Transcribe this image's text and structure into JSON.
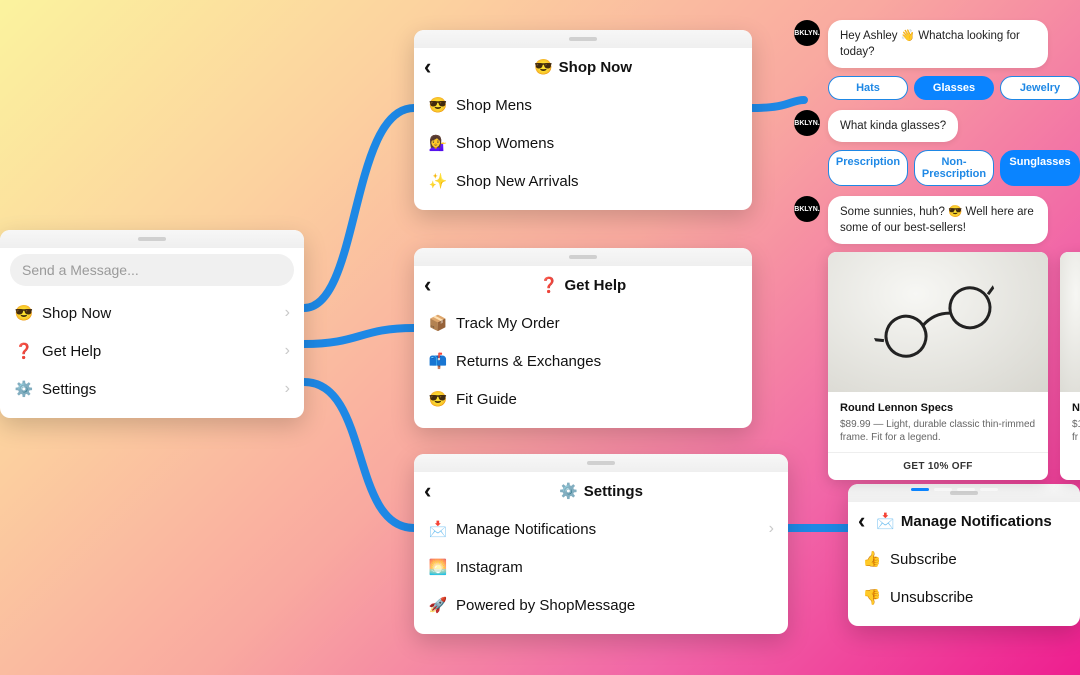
{
  "root": {
    "search_placeholder": "Send a Message...",
    "items": [
      {
        "icon": "😎",
        "label": "Shop Now"
      },
      {
        "icon": "❓",
        "label": "Get Help"
      },
      {
        "icon": "⚙️",
        "label": "Settings"
      }
    ]
  },
  "shop": {
    "back": "‹",
    "title_icon": "😎",
    "title": "Shop Now",
    "items": [
      {
        "icon": "😎",
        "label": "Shop Mens"
      },
      {
        "icon": "💁‍♀️",
        "label": "Shop Womens"
      },
      {
        "icon": "✨",
        "label": "Shop New Arrivals"
      }
    ]
  },
  "help": {
    "back": "‹",
    "title_icon": "❓",
    "title": "Get Help",
    "items": [
      {
        "icon": "📦",
        "label": "Track My Order"
      },
      {
        "icon": "📫",
        "label": "Returns & Exchanges"
      },
      {
        "icon": "😎",
        "label": "Fit Guide"
      }
    ]
  },
  "settings": {
    "back": "‹",
    "title_icon": "⚙️",
    "title": "Settings",
    "items": [
      {
        "icon": "📩",
        "label": "Manage Notifications",
        "chev": true
      },
      {
        "icon": "🌅",
        "label": "Instagram"
      },
      {
        "icon": "🚀",
        "label": "Powered by ShopMessage"
      }
    ]
  },
  "notifications": {
    "back": "‹",
    "title_icon": "📩",
    "title": "Manage Notifications",
    "items": [
      {
        "icon": "👍",
        "label": "Subscribe"
      },
      {
        "icon": "👎",
        "label": "Unsubscribe"
      }
    ]
  },
  "chat": {
    "brand": "BKLYN.",
    "msg1": "Hey Ashley 👋 Whatcha looking for today?",
    "chips1": [
      "Hats",
      "Glasses",
      "Jewelry"
    ],
    "chips1_selected": 1,
    "msg2": "What kinda glasses?",
    "chips2": [
      "Prescription",
      "Non-Prescription",
      "Sunglasses"
    ],
    "chips2_selected": 2,
    "msg3": "Some sunnies, huh? 😎 Well here are some of our best-sellers!",
    "product": {
      "title": "Round Lennon Specs",
      "desc": "$89.99 — Light, durable classic thin-rimmed frame. Fit for a legend.",
      "cta": "GET 10% OFF"
    },
    "product2": {
      "title": "N",
      "desc": "$1\nfr"
    }
  }
}
